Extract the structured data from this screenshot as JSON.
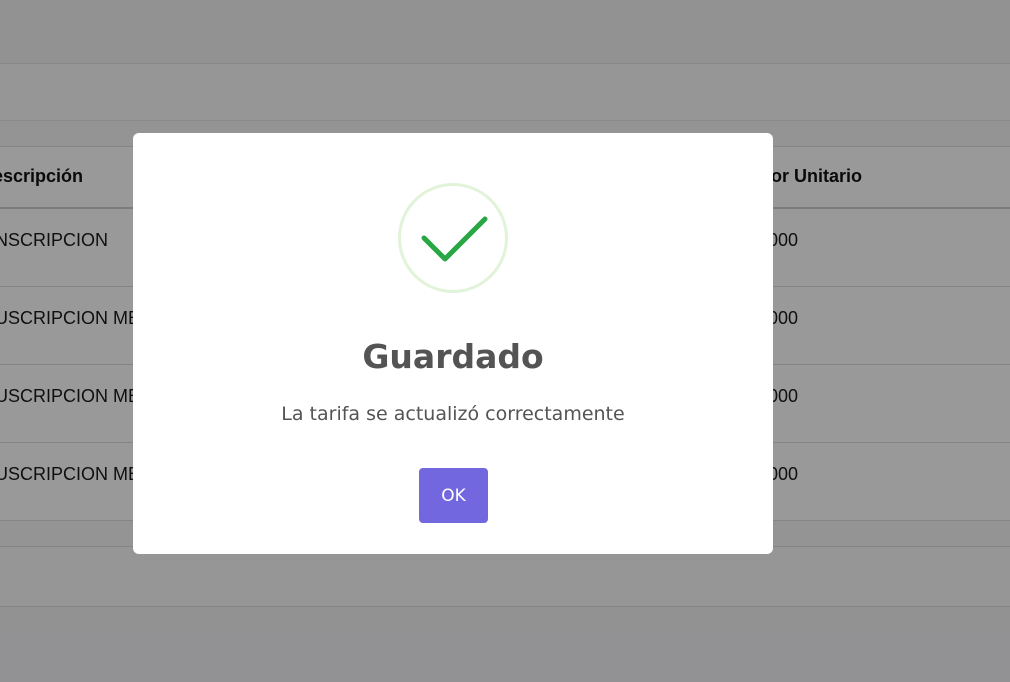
{
  "table": {
    "headers": {
      "description": "escripción",
      "unit_value": "lor Unitario"
    },
    "rows": [
      {
        "description": "NSCRIPCION",
        "unit_value": "000"
      },
      {
        "description": "USCRIPCION ME",
        "unit_value": "000"
      },
      {
        "description": "USCRIPCION ME",
        "unit_value": "000"
      },
      {
        "description": "USCRIPCION ME",
        "unit_value": "000"
      }
    ]
  },
  "dialog": {
    "icon": "success-check-icon",
    "title": "Guardado",
    "message": "La tarifa se actualizó correctamente",
    "confirm_label": "OK",
    "colors": {
      "confirm_button": "#7367e0",
      "check": "#29a745",
      "ring": "#e1f3d8",
      "text": "#545454"
    }
  }
}
